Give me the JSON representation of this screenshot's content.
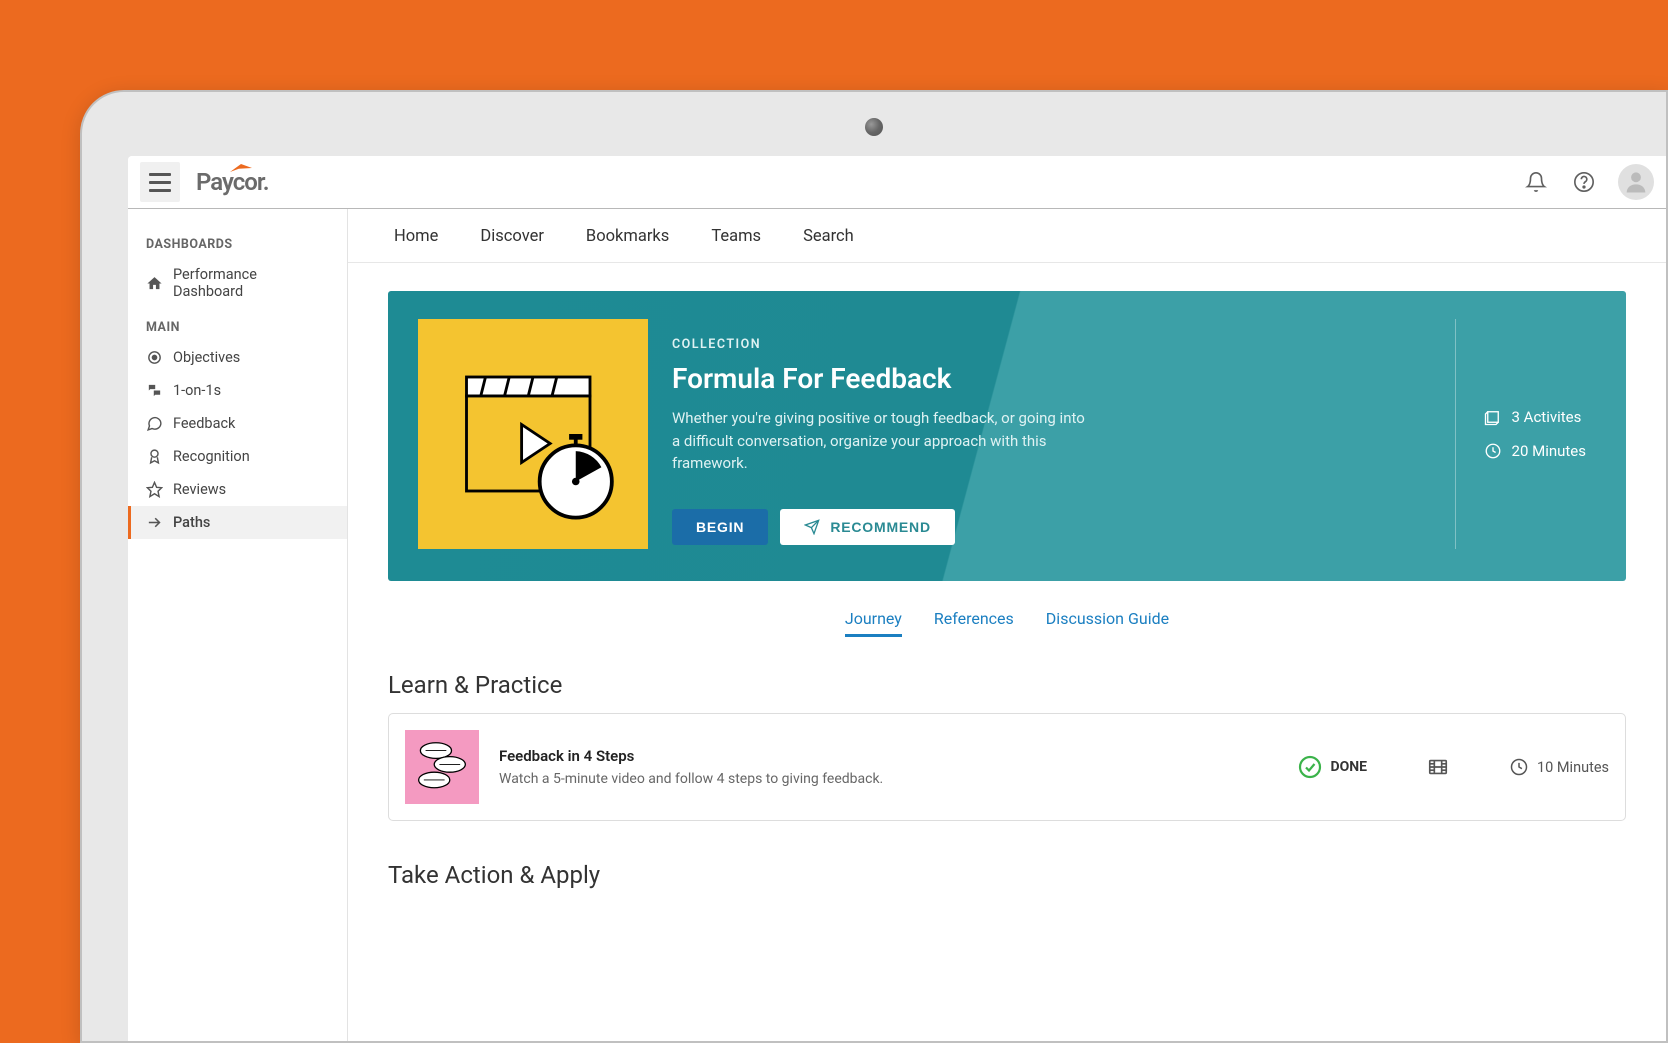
{
  "brand": "Paycor.",
  "sidebar": {
    "section1_title": "DASHBOARDS",
    "section2_title": "MAIN",
    "items_dashboards": [
      {
        "label": "Performance Dashboard"
      }
    ],
    "items_main": [
      {
        "label": "Objectives"
      },
      {
        "label": "1-on-1s"
      },
      {
        "label": "Feedback"
      },
      {
        "label": "Recognition"
      },
      {
        "label": "Reviews"
      },
      {
        "label": "Paths"
      }
    ]
  },
  "content_tabs": [
    {
      "label": "Home"
    },
    {
      "label": "Discover"
    },
    {
      "label": "Bookmarks"
    },
    {
      "label": "Teams"
    },
    {
      "label": "Search"
    }
  ],
  "hero": {
    "kicker": "COLLECTION",
    "title": "Formula For Feedback",
    "description": "Whether you're giving positive or tough feedback, or going into a difficult conversation, organize your approach with this framework.",
    "begin_label": "BEGIN",
    "recommend_label": "RECOMMEND",
    "stats": {
      "activities": "3 Activites",
      "minutes": "20 Minutes"
    }
  },
  "subtabs": [
    {
      "label": "Journey",
      "active": true
    },
    {
      "label": "References"
    },
    {
      "label": "Discussion Guide"
    }
  ],
  "section1_title": "Learn & Practice",
  "section2_title": "Take Action & Apply",
  "card1": {
    "title": "Feedback in 4 Steps",
    "description": "Watch a 5-minute video and follow 4 steps to giving feedback.",
    "status": "DONE",
    "duration": "10 Minutes"
  }
}
